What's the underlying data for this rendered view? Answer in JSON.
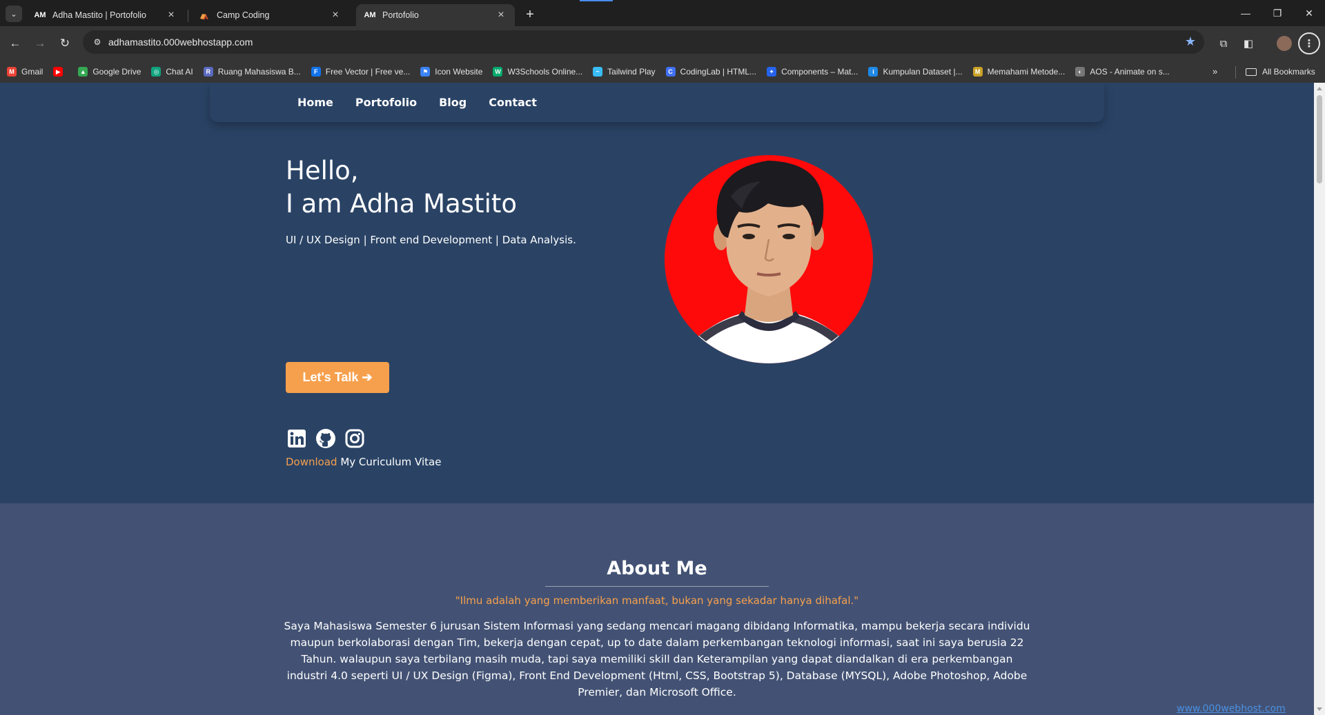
{
  "browser": {
    "tabs": [
      {
        "title": "Adha Mastito | Portofolio",
        "favicon": "AM",
        "active": false
      },
      {
        "title": "Camp Coding",
        "favicon": "camp-icon",
        "active": false
      },
      {
        "title": "Portofolio",
        "favicon": "AM",
        "active": true
      }
    ],
    "url": "adhamastito.000webhostapp.com",
    "bookmarks": [
      {
        "label": "Gmail",
        "color": "#ea4335",
        "glyph": "M"
      },
      {
        "label": "",
        "color": "#ff0000",
        "glyph": "▶"
      },
      {
        "label": "Google Drive",
        "color": "#34a853",
        "glyph": "▲"
      },
      {
        "label": "Chat AI",
        "color": "#10a37f",
        "glyph": "◎"
      },
      {
        "label": "Ruang Mahasiswa B...",
        "color": "#5b6bc0",
        "glyph": "R"
      },
      {
        "label": "Free Vector | Free ve...",
        "color": "#1273eb",
        "glyph": "F"
      },
      {
        "label": "Icon Website",
        "color": "#3b82f6",
        "glyph": "⚑"
      },
      {
        "label": "W3Schools Online...",
        "color": "#04aa6d",
        "glyph": "W"
      },
      {
        "label": "Tailwind Play",
        "color": "#38bdf8",
        "glyph": "~"
      },
      {
        "label": "CodingLab | HTML...",
        "color": "#4070f4",
        "glyph": "C"
      },
      {
        "label": "Components – Mat...",
        "color": "#2563eb",
        "glyph": "✦"
      },
      {
        "label": "Kumpulan Dataset |...",
        "color": "#1e88e5",
        "glyph": "i"
      },
      {
        "label": "Memahami Metode...",
        "color": "#c9a227",
        "glyph": "M"
      },
      {
        "label": "AOS - Animate on s...",
        "color": "#777777",
        "glyph": "◐"
      }
    ],
    "bookmarks_more": "»",
    "all_bookmarks": "All Bookmarks"
  },
  "site": {
    "nav": [
      "Home",
      "Portofolio",
      "Blog",
      "Contact"
    ],
    "hero": {
      "greeting_line1": "Hello,",
      "greeting_line2": "I am Adha Mastito",
      "roles": "UI / UX Design | Front end Development | Data Analysis.",
      "cta": "Let's Talk ➔",
      "cv_download": "Download",
      "cv_rest": " My Curiculum Vitae",
      "photo_bg": "#ff0a0a"
    },
    "socials": [
      "linkedin-icon",
      "github-icon",
      "instagram-icon"
    ],
    "about": {
      "title": "About Me",
      "quote": "\"Ilmu adalah yang memberikan manfaat, bukan yang sekadar hanya dihafal.\"",
      "body": "Saya Mahasiswa Semester 6 jurusan Sistem Informasi yang sedang mencari magang dibidang Informatika, mampu bekerja secara individu maupun berkolaborasi dengan Tim, bekerja dengan cepat, up to date dalam perkembangan teknologi informasi, saat ini saya berusia 22 Tahun. walaupun saya terbilang masih muda, tapi saya memiliki skill dan Keterampilan yang dapat diandalkan di era perkembangan industri 4.0 seperti UI / UX Design (Figma), Front End Development (Html, CSS, Bootstrap 5), Database (MYSQL), Adobe Photoshop, Adobe Premier, dan Microsoft Office."
    },
    "hosting_badge": "www.000webhost.com",
    "colors": {
      "accent": "#f6a04d",
      "hero_bg": "#2a4365",
      "about_bg": "#435274"
    }
  }
}
